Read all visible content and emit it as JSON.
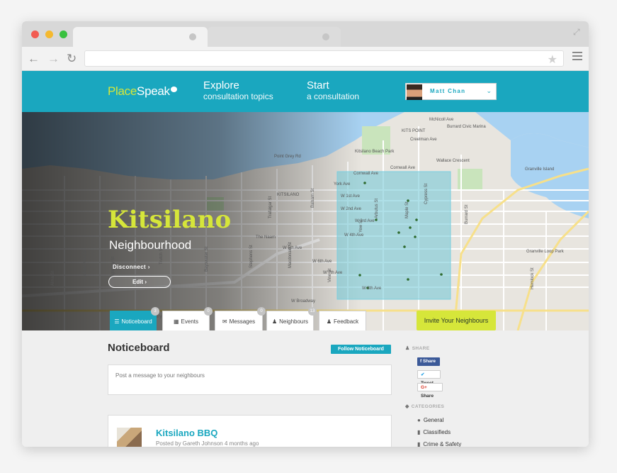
{
  "site": {
    "logo_part1": "Place",
    "logo_part2": "Speak",
    "nav": [
      {
        "big": "Explore",
        "small": "consultation topics"
      },
      {
        "big": "Start",
        "small": "a consultation"
      }
    ],
    "user_name": "Matt Chan"
  },
  "hero": {
    "title": "Kitsilano",
    "subtitle": "Neighbourhood",
    "disconnect_label": "Disconnect",
    "edit_label": "Edit",
    "map_labels": [
      "Burrard Civic Marina",
      "KITS POINT",
      "York Ave",
      "Point Grey Rd",
      "Cornwall Ave",
      "W 1st Ave",
      "W 2nd Ave",
      "W 3rd Ave",
      "W 4th Ave",
      "W 5th Ave",
      "W 6th Ave",
      "W 7th Ave",
      "W 8th Ave",
      "W Broadway",
      "Kitsilano Beach Park",
      "KITSILANO",
      "The Naam",
      "Granville Island",
      "Granville Loop Park",
      "The Eatery",
      "Arbutus St",
      "Maple St",
      "Cypress St",
      "Yew St",
      "Vine St",
      "Balsam St",
      "Trafalgar St",
      "Stephens St",
      "Macdonald St",
      "Bayswater St",
      "Trutch St",
      "Alma St",
      "Collingwood St",
      "Highbury St",
      "Burrard St",
      "Hemlock St",
      "Cornwall Ave",
      "McNicoll Ave",
      "Creelman Ave",
      "Wallace Crescent"
    ]
  },
  "tabs": [
    {
      "label": "Noticeboard",
      "icon": "list-icon",
      "count": "3",
      "active": true
    },
    {
      "label": "Events",
      "icon": "calendar-icon",
      "count": "0",
      "active": false
    },
    {
      "label": "Messages",
      "icon": "envelope-icon",
      "count": "0",
      "active": false
    },
    {
      "label": "Neighbours",
      "icon": "user-icon",
      "count": "13",
      "active": false
    },
    {
      "label": "Feedback",
      "icon": "user-icon",
      "count": "",
      "active": false
    }
  ],
  "invite_label": "Invite Your Neighbours",
  "noticeboard": {
    "title": "Noticeboard",
    "follow_label": "Follow Noticeboard",
    "post_placeholder": "Post a message to your neighbours",
    "posts": [
      {
        "title": "Kitsilano BBQ",
        "meta": "Posted by Gareth Johnson 4 months ago"
      }
    ]
  },
  "sidebar": {
    "share_label": "SHARE",
    "share_buttons": [
      "Share",
      "Tweet",
      "Share"
    ],
    "categories_label": "CATEGORIES",
    "categories": [
      "General",
      "Classifieds",
      "Crime & Safety"
    ]
  },
  "colors": {
    "brand_teal": "#1aa7bf",
    "brand_lime": "#d6e63a",
    "facebook": "#3b5998"
  }
}
